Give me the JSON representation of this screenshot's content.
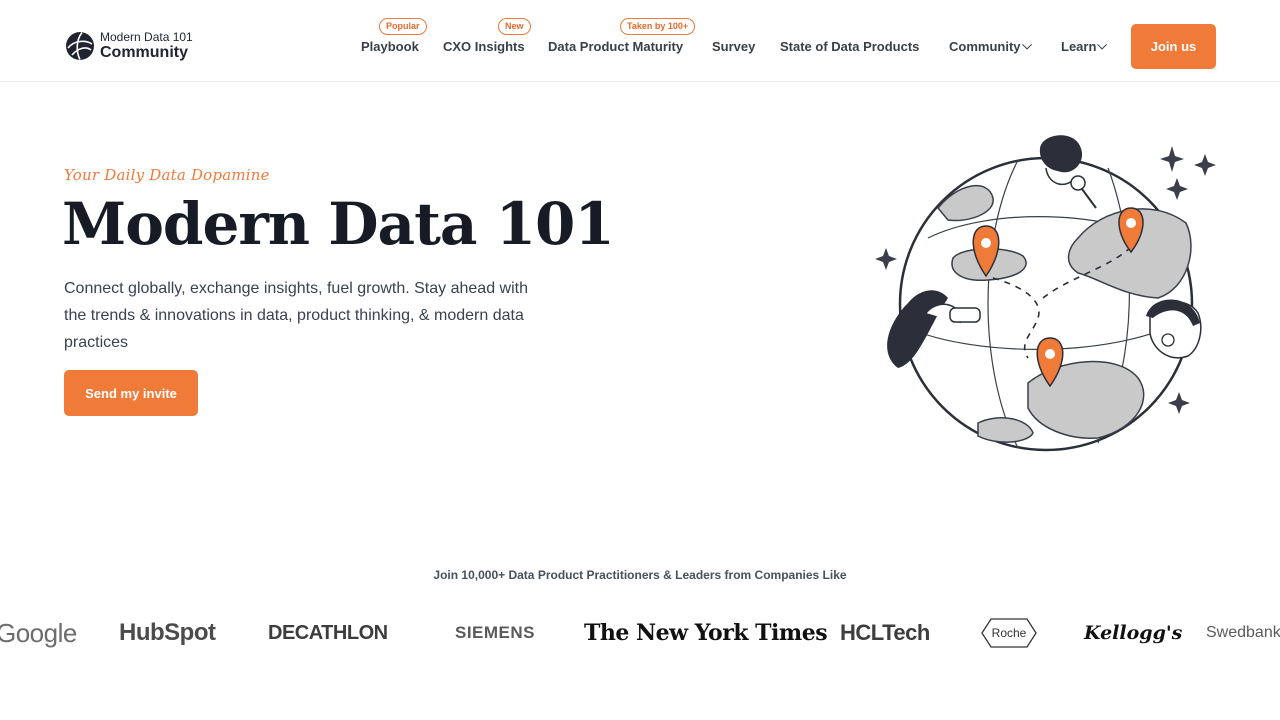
{
  "brand": {
    "name_top": "Modern Data 101",
    "name_bottom": "Community",
    "accent": "#f07a38"
  },
  "nav": {
    "items": [
      {
        "label": "Playbook",
        "badge": "Popular"
      },
      {
        "label": "CXO Insights",
        "badge": "New"
      },
      {
        "label": "Data Product Maturity",
        "badge": "Taken by 100+"
      },
      {
        "label": "Survey"
      },
      {
        "label": "State of Data Products"
      },
      {
        "label": "Community",
        "icon": "chevron-down-icon"
      },
      {
        "label": "Learn",
        "icon": "chevron-down-icon"
      }
    ],
    "cta_label": "Join us"
  },
  "hero": {
    "tagline": "Your Daily Data Dopamine",
    "title": "Modern Data 101",
    "description": "Connect globally, exchange insights, fuel growth. Stay ahead with the trends & innovations in data, product thinking, & modern data practices",
    "cta_label": "Send my invite"
  },
  "companies": {
    "heading": "Join 10,000+ Data Product Practitioners & Leaders from Companies Like",
    "logos": [
      "Google",
      "HubSpot",
      "DECATHLON",
      "SIEMENS",
      "The New York Times",
      "HCLTech",
      "Roche",
      "Kellogg's",
      "Swedbank"
    ]
  }
}
